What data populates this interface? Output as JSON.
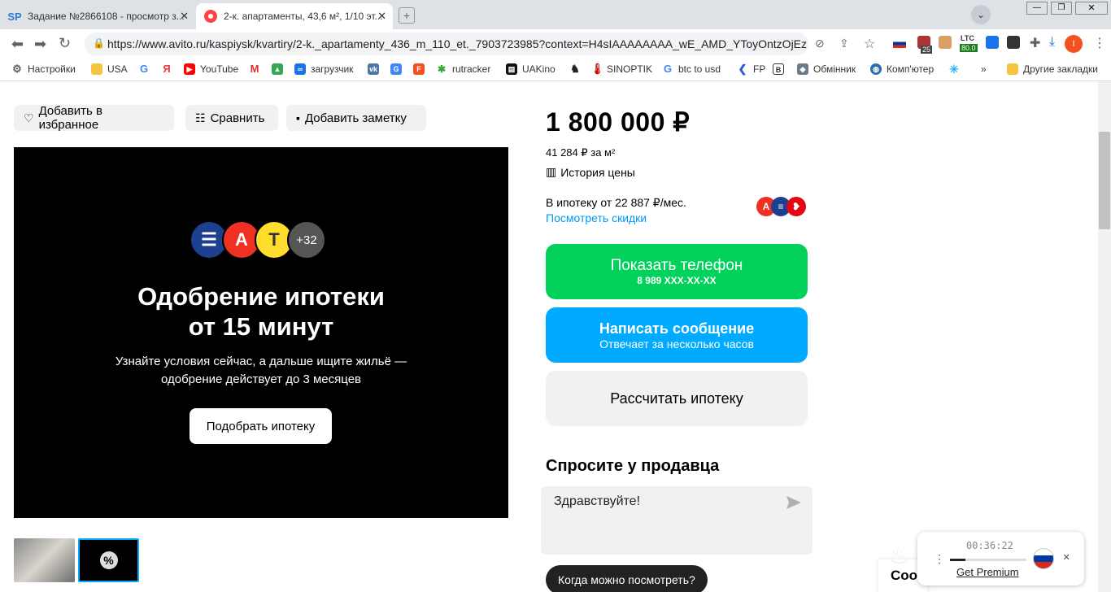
{
  "browser": {
    "tabs": [
      {
        "title": "Задание №2866108 - просмотр з...",
        "favicon": "SP",
        "active": false
      },
      {
        "title": "2-к. апартаменты, 43,6 м², 1/10 эт...",
        "favicon": "avito",
        "active": true
      }
    ],
    "url": "https://www.avito.ru/kaspiysk/kvartiry/2-k._apartamenty_436_m_110_et._7903723985?context=H4sIAAAAAAAA_wE_AMD_YToyOntzOjEz...",
    "extensions": {
      "badge_count": "25",
      "ltc_label": "LTC",
      "ltc_value": "80.0"
    },
    "bookmarks": [
      "Настройки",
      "USA",
      "YouTube",
      "загрузчик",
      "rutracker",
      "UAKino",
      "SINOPTIK",
      "btc to usd",
      "FP",
      "Обмінник",
      "Комп'ютер",
      "Другие закладки"
    ]
  },
  "actions": {
    "favorite": "Добавить в избранное",
    "compare": "Сравнить",
    "note": "Добавить заметку"
  },
  "gallery": {
    "extra_banks": "+32",
    "title_line1": "Одобрение ипотеки",
    "title_line2": "от 15 минут",
    "subtitle_line1": "Узнайте условия сейчас, а дальше ищите жильё —",
    "subtitle_line2": "одобрение действует до 3 месяцев",
    "button": "Подобрать ипотеку"
  },
  "listing": {
    "price": "1 800 000 ₽",
    "price_per_m2": "41 284 ₽ за м²",
    "price_history": "История цены",
    "mortgage_from": "В ипотеку от 22 887 ₽/мес.",
    "see_discounts": "Посмотреть скидки"
  },
  "contact": {
    "show_phone": "Показать телефон",
    "phone_masked": "8 989 XXX-XX-XX",
    "write_message": "Написать сообщение",
    "reply_time": "Отвечает за несколько часов",
    "calc_mortgage": "Рассчитать ипотеку"
  },
  "ask": {
    "title": "Спросите у продавца",
    "draft": "Здравствуйте!",
    "quick_question": "Когда можно посмотреть?"
  },
  "vpn_widget": {
    "timer": "00:36:22",
    "premium": "Get Premium"
  },
  "cookie_partial": "Coo"
}
